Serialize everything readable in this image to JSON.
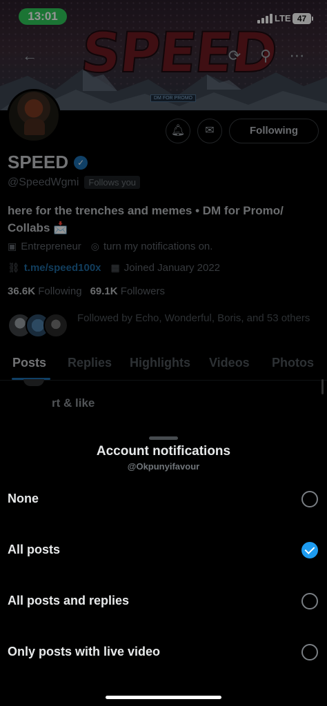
{
  "status_bar": {
    "time": "13:01",
    "network": "LTE",
    "battery": "47"
  },
  "banner": {
    "title": "SPEED",
    "tag": "DM FOR PROMO"
  },
  "profile": {
    "actions": {
      "following_label": "Following"
    },
    "name": "SPEED",
    "handle": "@SpeedWgmi",
    "follows_you": "Follows you",
    "bio": "here for the trenches and memes • DM for Promo/ Collabs 📩",
    "category": "Entrepreneur",
    "location": "turn my notifications on.",
    "link": "t.me/speed100x",
    "joined": "Joined January 2022",
    "stats": {
      "following_count": "36.6K",
      "following_label": "Following",
      "followers_count": "69.1K",
      "followers_label": "Followers"
    },
    "followed_by": "Followed by Echo, Wonderful, Boris, and 53 others"
  },
  "tabs": [
    "Posts",
    "Replies",
    "Highlights",
    "Videos",
    "Photos"
  ],
  "post_snippet": "rt & like",
  "sheet": {
    "title": "Account notifications",
    "subtitle": "@Okpunyifavour",
    "options": [
      {
        "label": "None",
        "selected": false
      },
      {
        "label": "All posts",
        "selected": true
      },
      {
        "label": "All posts and replies",
        "selected": false
      },
      {
        "label": "Only posts with live video",
        "selected": false
      }
    ]
  },
  "colors": {
    "accent": "#1d9bf0",
    "time_pill": "#2fc85a"
  }
}
